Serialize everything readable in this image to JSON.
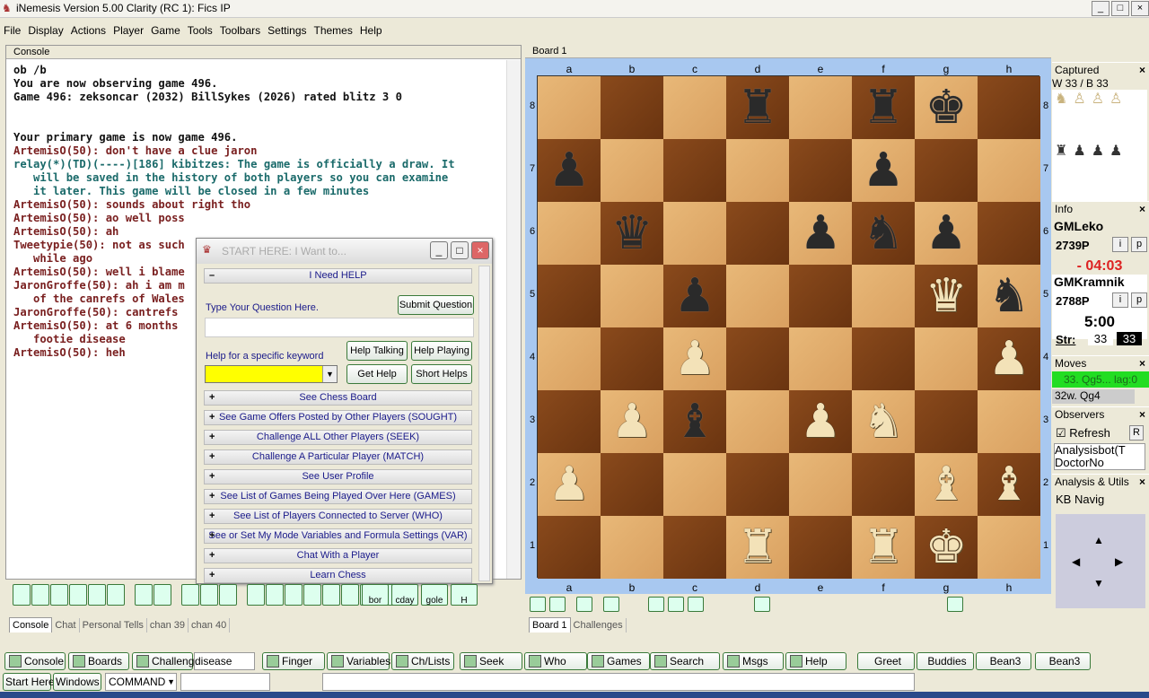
{
  "window": {
    "title": "iNemesis Version 5.00 Clarity (RC 1): Fics IP"
  },
  "menu": [
    "File",
    "Display",
    "Actions",
    "Player",
    "Game",
    "Tools",
    "Toolbars",
    "Settings",
    "Themes",
    "Help"
  ],
  "console": {
    "title": "Console",
    "lines": [
      {
        "t": "ob /b",
        "c": "black"
      },
      {
        "t": "You are now observing game 496.",
        "c": "black"
      },
      {
        "t": "Game 496: zeksoncar (2032) BillSykes (2026) rated blitz 3 0",
        "c": "black"
      },
      {
        "t": "",
        "c": "black"
      },
      {
        "t": "",
        "c": "black"
      },
      {
        "t": "Your primary game is now game 496.",
        "c": "black"
      },
      {
        "t": "ArtemisO(50): don't have a clue jaron",
        "c": "red"
      },
      {
        "t": "relay(*)(TD)(----)[186] kibitzes: The game is officially a draw. It",
        "c": "teal"
      },
      {
        "t": "   will be saved in the history of both players so you can examine",
        "c": "teal"
      },
      {
        "t": "   it later. This game will be closed in a few minutes",
        "c": "teal"
      },
      {
        "t": "ArtemisO(50): sounds about right tho",
        "c": "red"
      },
      {
        "t": "ArtemisO(50): ao well poss",
        "c": "red"
      },
      {
        "t": "ArtemisO(50): ah",
        "c": "red"
      },
      {
        "t": "Tweetypie(50): not as such",
        "c": "red"
      },
      {
        "t": "   while ago",
        "c": "red"
      },
      {
        "t": "ArtemisO(50): well i blame",
        "c": "red"
      },
      {
        "t": "JaronGroffe(50): ah i am m",
        "c": "red"
      },
      {
        "t": "   of the canrefs of Wales",
        "c": "red"
      },
      {
        "t": "JaronGroffe(50): cantrefs",
        "c": "red"
      },
      {
        "t": "ArtemisO(50): at 6 months",
        "c": "red"
      },
      {
        "t": "   footie disease",
        "c": "red"
      },
      {
        "t": "ArtemisO(50): heh",
        "c": "red"
      }
    ],
    "tabs": [
      "Console",
      "Chat",
      "Personal Tells",
      "chan 39",
      "chan 40"
    ],
    "toolbar_buttons": [
      "bor",
      "cday",
      "gole",
      "H"
    ]
  },
  "dialog": {
    "title": "START HERE: I Want to...",
    "section_open": "I Need HELP",
    "question_label": "Type Your Question Here.",
    "question_value": "",
    "submit": "Submit Question",
    "keyword_label": "Help for a specific keyword",
    "keyword_value": "",
    "help_talking": "Help Talking",
    "help_playing": "Help Playing",
    "get_help": "Get Help",
    "short_helps": "Short Helps",
    "sections": [
      "See Chess Board",
      "See Game Offers Posted by Other Players (SOUGHT)",
      "Challenge ALL Other Players (SEEK)",
      "Challenge A Particular Player (MATCH)",
      "See User Profile",
      "See List of Games Being Played Over Here (GAMES)",
      "See List of Players Connected to Server (WHO)",
      "See or Set My Mode Variables and Formula Settings (VAR)",
      "Chat With a Player",
      "Learn Chess"
    ]
  },
  "board": {
    "title": "Board 1",
    "files": [
      "a",
      "b",
      "c",
      "d",
      "e",
      "f",
      "g",
      "h"
    ],
    "ranks": [
      "8",
      "7",
      "6",
      "5",
      "4",
      "3",
      "2",
      "1"
    ],
    "position": [
      "...r.rk.",
      "p....p..",
      ".q..pnp.",
      "..p...Qn",
      "..P....P",
      ".Pb.PN..",
      "P.....BB",
      "...R.RK."
    ],
    "tabs": [
      "Board 1",
      "Challenges"
    ]
  },
  "captured": {
    "title": "Captured",
    "count": "W 33 / B 33"
  },
  "info": {
    "title": "Info",
    "p1": {
      "name": "GMLeko",
      "rating": "2739P",
      "clock": "- 04:03"
    },
    "p2": {
      "name": "GMKramnik",
      "rating": "2788P",
      "clock": "5:00"
    },
    "i": "i",
    "p": "p",
    "str_label": "Str:",
    "str_w": "33",
    "str_b": "33"
  },
  "moves": {
    "title": "Moves",
    "current": "33. Qg5... lag:0",
    "prev": "32w. Qg4"
  },
  "observers": {
    "title": "Observers",
    "refresh": "Refresh",
    "r": "R",
    "list": [
      "Analysisbot(T",
      "DoctorNo"
    ]
  },
  "analysis": {
    "title": "Analysis & Utils",
    "tab": "KB Navig"
  },
  "bottom_toolbar": {
    "buttons": [
      "Console",
      "Boards",
      "Challengs"
    ],
    "input_value": "disease",
    "buttons2": [
      "Finger",
      "Variables",
      "Ch/Lists",
      "Seek",
      "Who",
      "Games",
      "Search",
      "Msgs",
      "Help",
      "Greet",
      "Buddies",
      "Bean3",
      "Bean3"
    ]
  },
  "command_bar": {
    "start": "Start Here",
    "windows": "Windows",
    "mode": "COMMAND"
  },
  "colors": {
    "light_square": "#e0ad6c",
    "dark_square": "#7a3e16",
    "board_bg": "#a8c8f0",
    "moves_highlight": "#22dd22",
    "clock_red": "#dd2222"
  }
}
